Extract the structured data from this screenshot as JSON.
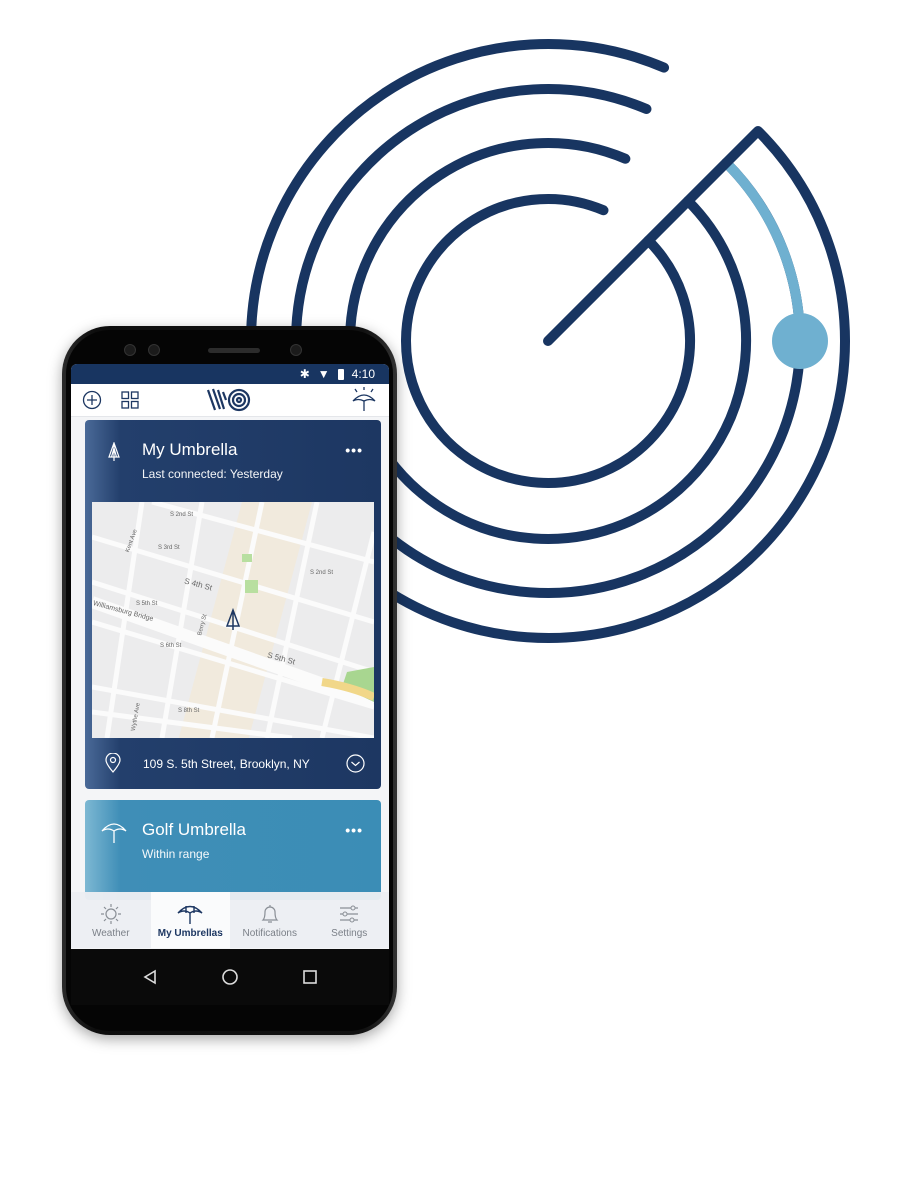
{
  "colors": {
    "navy": "#183561",
    "accent_light_blue": "#6fb0d0",
    "card1": "#1d3762",
    "card2": "#3b8db6"
  },
  "status_bar": {
    "time": "4:10",
    "icons": [
      "bluetooth-icon",
      "wifi-icon",
      "battery-icon"
    ]
  },
  "app_bar": {
    "left_icons": [
      "add-circle-icon",
      "grid-icon"
    ],
    "logo": "WG",
    "right_icon": "umbrella-weather-icon"
  },
  "cards": [
    {
      "title": "My Umbrella",
      "subtitle": "Last connected: Yesterday",
      "menu": "•••",
      "address": "109 S. 5th Street, Brooklyn, NY",
      "map_labels": [
        "S 2nd St",
        "S 3rd St",
        "Kent Ave",
        "S 2nd St",
        "S 4th St",
        "S 5th St",
        "Williamsburg Bridge",
        "Berry St",
        "S 6th St",
        "S 5th St",
        "S 8th St",
        "Wythe Ave"
      ]
    },
    {
      "title": "Golf Umbrella",
      "subtitle": "Within range",
      "menu": "•••"
    }
  ],
  "bottom_nav": [
    {
      "label": "Weather",
      "icon": "sun-icon",
      "active": false
    },
    {
      "label": "My Umbrellas",
      "icon": "umbrella-icon",
      "active": true
    },
    {
      "label": "Notifications",
      "icon": "bell-icon",
      "active": false
    },
    {
      "label": "Settings",
      "icon": "sliders-icon",
      "active": false
    }
  ],
  "system_nav": [
    "back-icon",
    "home-icon",
    "recents-icon"
  ]
}
